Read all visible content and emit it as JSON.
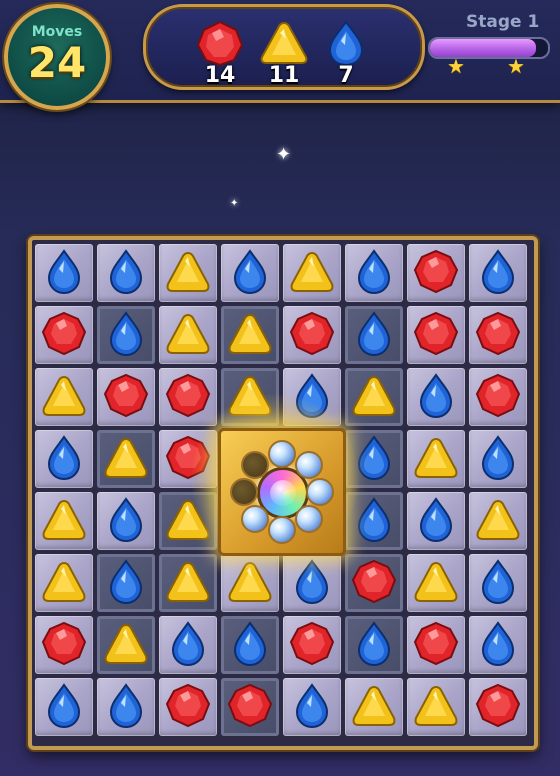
{
  "hud": {
    "moves_label": "Moves",
    "moves_value": "24",
    "stage_label": "Stage 1",
    "stage_progress": 0.9,
    "stars": 2
  },
  "goals": [
    {
      "gem": "red",
      "count": "14"
    },
    {
      "gem": "yellow",
      "count": "11"
    },
    {
      "gem": "blue",
      "count": "7"
    }
  ],
  "colors": {
    "red": "#e0242a",
    "yellow": "#f2c21a",
    "blue": "#1f63d6",
    "frame_gold": "#c39a54"
  },
  "board": {
    "rows": 8,
    "cols": 8,
    "grid": [
      [
        "blue",
        "blue",
        "yellow",
        "blue",
        "yellow",
        "blue",
        "red",
        "blue"
      ],
      [
        "red",
        "blue",
        "yellow",
        "yellow",
        "red",
        "blue",
        "red",
        "red"
      ],
      [
        "yellow",
        "red",
        "red",
        "yellow",
        "blue",
        "yellow",
        "blue",
        "red"
      ],
      [
        "blue",
        "yellow",
        "red",
        "boss",
        "boss",
        "blue",
        "yellow",
        "blue"
      ],
      [
        "yellow",
        "blue",
        "yellow",
        "boss",
        "boss",
        "blue",
        "blue",
        "yellow"
      ],
      [
        "yellow",
        "blue",
        "yellow",
        "yellow",
        "blue",
        "red",
        "yellow",
        "blue"
      ],
      [
        "red",
        "yellow",
        "blue",
        "blue",
        "red",
        "blue",
        "red",
        "blue"
      ],
      [
        "blue",
        "blue",
        "red",
        "red",
        "blue",
        "yellow",
        "yellow",
        "red"
      ]
    ],
    "dark_cells": [
      [
        1,
        1
      ],
      [
        1,
        3
      ],
      [
        1,
        5
      ],
      [
        2,
        3
      ],
      [
        2,
        5
      ],
      [
        3,
        1
      ],
      [
        3,
        5
      ],
      [
        4,
        2
      ],
      [
        4,
        5
      ],
      [
        5,
        1
      ],
      [
        5,
        2
      ],
      [
        5,
        5
      ],
      [
        6,
        1
      ],
      [
        6,
        3
      ],
      [
        6,
        5
      ],
      [
        7,
        3
      ]
    ],
    "boss": {
      "type": "rainbow-bomb-cage",
      "orbs_filled": 6,
      "orbs_total": 8
    }
  }
}
